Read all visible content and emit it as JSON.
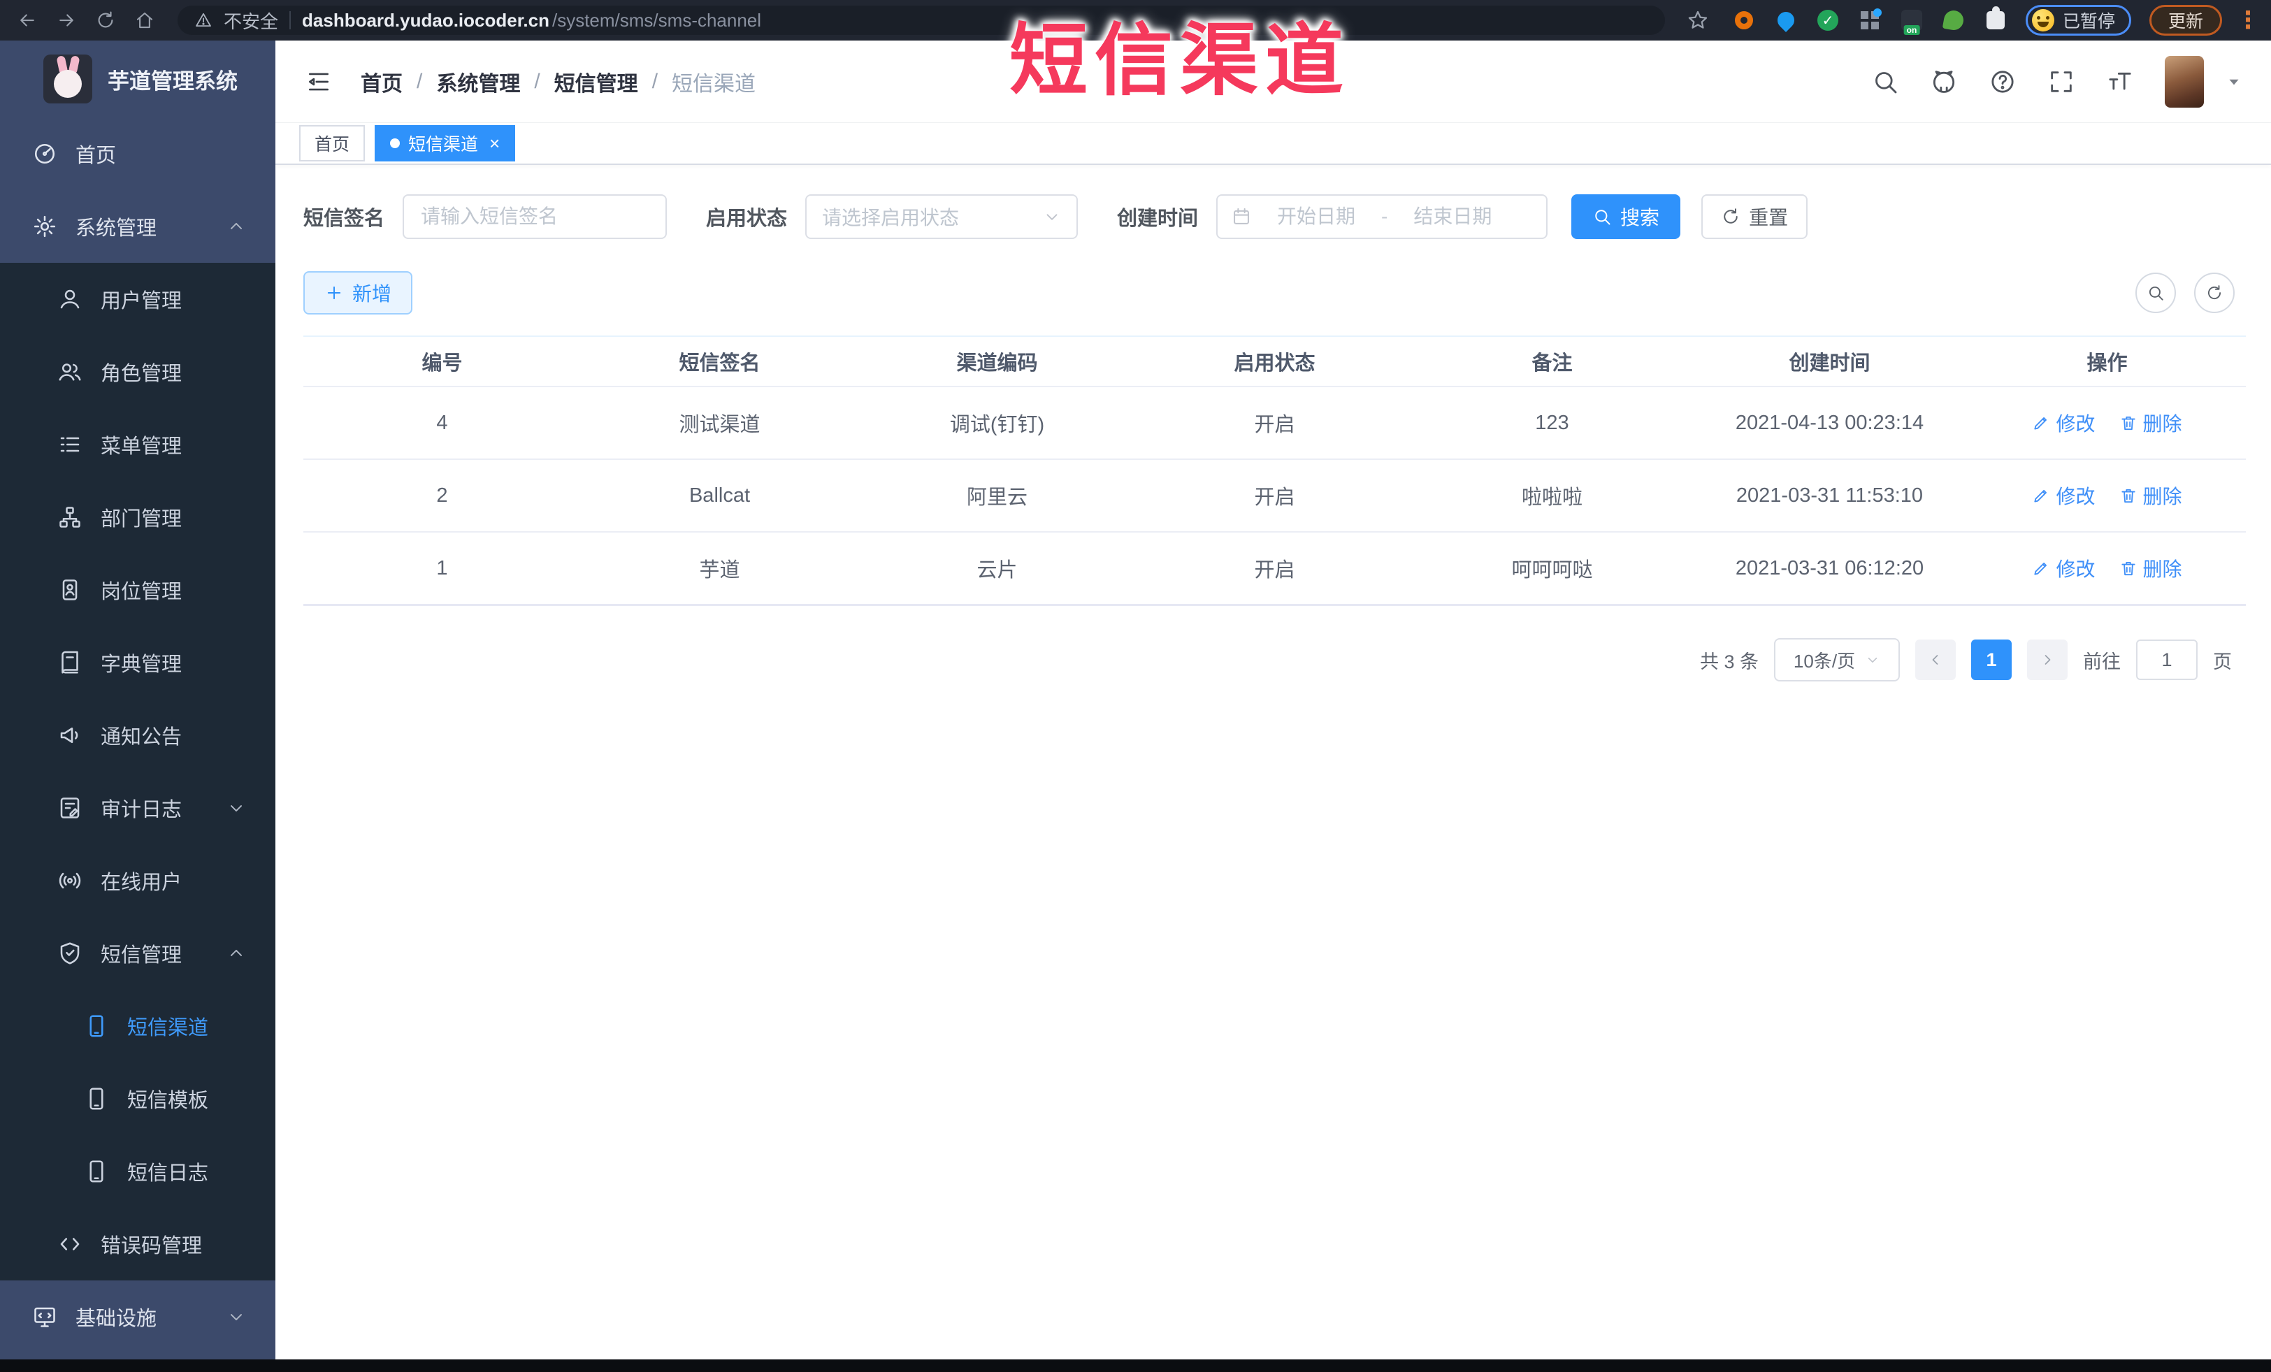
{
  "icons": {
    "kebab": "⋮",
    "close": "×",
    "check": "✓",
    "on_badge": "on"
  },
  "browser": {
    "security_label": "不安全",
    "url_domain": "dashboard.yudao.iocoder.cn",
    "url_path": "/system/sms/sms-channel",
    "profile_status": "已暂停",
    "update_label": "更新"
  },
  "watermark": "短信渠道",
  "sidebar": {
    "title": "芋道管理系统",
    "items": [
      {
        "label": "首页",
        "icon": "dashboard-icon"
      },
      {
        "label": "系统管理",
        "icon": "gear-icon",
        "expanded": true
      },
      {
        "label": "用户管理",
        "icon": "user-icon"
      },
      {
        "label": "角色管理",
        "icon": "users-icon"
      },
      {
        "label": "菜单管理",
        "icon": "list-icon"
      },
      {
        "label": "部门管理",
        "icon": "org-tree-icon"
      },
      {
        "label": "岗位管理",
        "icon": "badge-icon"
      },
      {
        "label": "字典管理",
        "icon": "book-icon"
      },
      {
        "label": "通知公告",
        "icon": "megaphone-icon"
      },
      {
        "label": "审计日志",
        "icon": "audit-log-icon",
        "expanded": false
      },
      {
        "label": "在线用户",
        "icon": "online-icon"
      },
      {
        "label": "短信管理",
        "icon": "shield-icon",
        "expanded": true
      },
      {
        "label": "短信渠道",
        "icon": "phone-icon",
        "active": true
      },
      {
        "label": "短信模板",
        "icon": "phone-icon"
      },
      {
        "label": "短信日志",
        "icon": "phone-icon"
      },
      {
        "label": "错误码管理",
        "icon": "code-icon"
      },
      {
        "label": "基础设施",
        "icon": "monitor-icon",
        "expanded": false
      }
    ]
  },
  "header": {
    "breadcrumb": [
      "首页",
      "系统管理",
      "短信管理",
      "短信渠道"
    ],
    "separator": "/"
  },
  "tabs": [
    {
      "label": "首页"
    },
    {
      "label": "短信渠道",
      "active": true
    }
  ],
  "search": {
    "sign_label": "短信签名",
    "sign_placeholder": "请输入短信签名",
    "status_label": "启用状态",
    "status_placeholder": "请选择启用状态",
    "time_label": "创建时间",
    "start_placeholder": "开始日期",
    "range_separator": "-",
    "end_placeholder": "结束日期",
    "search_label": "搜索",
    "reset_label": "重置"
  },
  "toolbar": {
    "add_label": "新增"
  },
  "table": {
    "headers": [
      "编号",
      "短信签名",
      "渠道编码",
      "启用状态",
      "备注",
      "创建时间",
      "操作"
    ],
    "rows": [
      [
        "4",
        "测试渠道",
        "调试(钉钉)",
        "开启",
        "123",
        "2021-04-13 00:23:14"
      ],
      [
        "2",
        "Ballcat",
        "阿里云",
        "开启",
        "啦啦啦",
        "2021-03-31 11:53:10"
      ],
      [
        "1",
        "芋道",
        "云片",
        "开启",
        "呵呵呵哒",
        "2021-03-31 06:12:20"
      ]
    ],
    "edit_label": "修改",
    "delete_label": "删除"
  },
  "pagination": {
    "total": "共 3 条",
    "page_size": "10条/页",
    "current_page": "1",
    "goto_label": "前往",
    "goto_value": "1",
    "unit_label": "页"
  },
  "colors": {
    "accent": "#2f92fb",
    "annotation": "#f5395c",
    "sidebar_bg": "#3c4a6b",
    "submenu_bg": "#1d2936"
  }
}
